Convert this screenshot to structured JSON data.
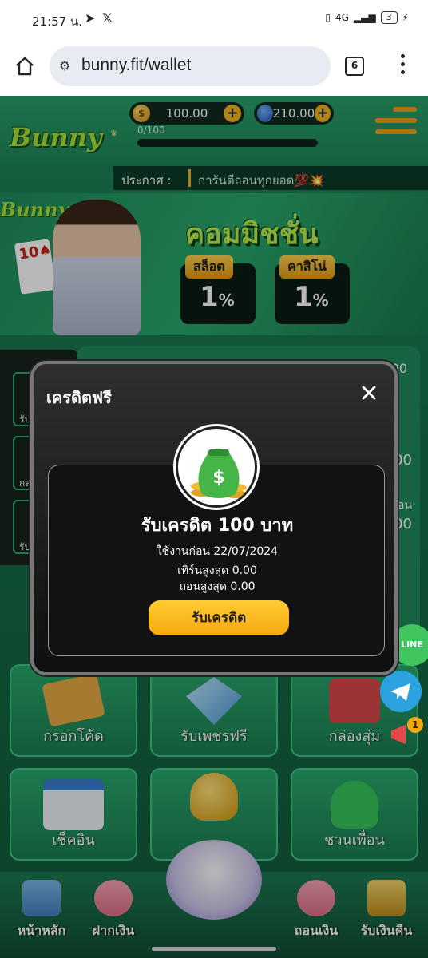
{
  "status_bar": {
    "time": "21:57 น.",
    "network": "4G",
    "battery": "3"
  },
  "browser": {
    "url": "bunny.fit/wallet",
    "tab_count": "6"
  },
  "header": {
    "logo_text": "Bunny",
    "coins": "100.00",
    "gems": "210.00",
    "xp": "0/100",
    "announce_label": "ประกาศ :",
    "announce_text": "การันตีถอนทุกยอด💯💥"
  },
  "banner": {
    "logo_text": "Bunny",
    "title": "คอมมิชชั่น",
    "tiles": [
      {
        "label": "สล็อต",
        "value": "1",
        "unit": "%"
      },
      {
        "label": "คาสิโน่",
        "value": "1",
        "unit": "%"
      }
    ]
  },
  "background_values": {
    "right_values": [
      "00",
      "00",
      "00"
    ],
    "right_label": "อน",
    "left_labels": [
      "รับ",
      "กล",
      "รับเ"
    ]
  },
  "grid": {
    "items": [
      {
        "label": "กรอกโค้ด"
      },
      {
        "label": "รับเพชรฟรี"
      },
      {
        "label": "กล่องสุ่ม"
      },
      {
        "label": "เช็คอิน"
      },
      {
        "label": ""
      },
      {
        "label": "ชวนเพื่อน"
      }
    ]
  },
  "side": {
    "line_label": "LINE",
    "notification_count": "1"
  },
  "bottom_nav": {
    "items": [
      {
        "label": "หน้าหลัก"
      },
      {
        "label": "ฝากเงิน"
      },
      {
        "label": "ถอนเงิน"
      },
      {
        "label": "รับเงินคืน"
      }
    ]
  },
  "modal": {
    "title": "เครดิตฟรี",
    "claim_title": "รับเครดิต 100 บาท",
    "use_before": "ใช้งานก่อน 22/07/2024",
    "max_turnover": "เทิร์นสูงสุด 0.00",
    "max_withdraw": "ถอนสูงสุด 0.00",
    "claim_button": "รับเครดิต"
  },
  "colors": {
    "accent_yellow": "#f5a90e",
    "brand_green": "#1f8a5c",
    "modal_bg": "#121212"
  }
}
